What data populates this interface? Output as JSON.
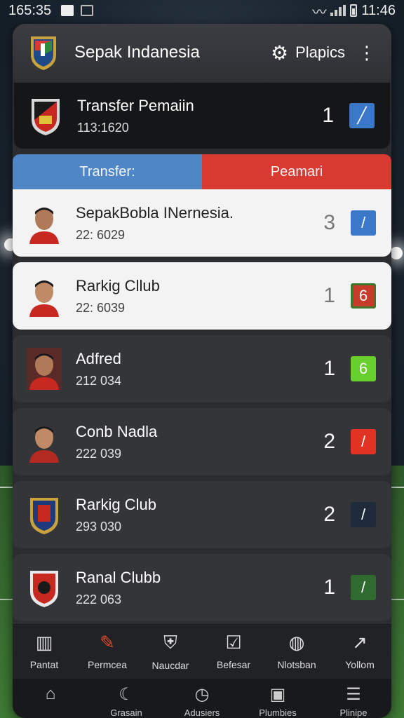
{
  "status": {
    "time": "165:35",
    "right_time": "11:46"
  },
  "header": {
    "title": "Sepak Indanesia",
    "settings_label": "Plapics",
    "gear_icon": "gear-icon",
    "more_icon": "more-vertical-icon"
  },
  "transfer": {
    "name": "Transfer Pemaiin",
    "sub": "113:1620",
    "count": "1",
    "badge_color": "#3a78c9"
  },
  "tabs": [
    {
      "label": "Transfer:",
      "color": "#4f87c6"
    },
    {
      "label": "Peamari",
      "color": "#d83a32"
    }
  ],
  "rows": [
    {
      "name": "SepakBobla INernesia.",
      "sub": "22: 6029",
      "count": "3",
      "badge": "/",
      "badge_color": "#3a78c9",
      "theme": "light"
    },
    {
      "name": "Rarkig Cllub",
      "sub": "22: 6039",
      "count": "1",
      "badge": "6",
      "badge_color": "#c73b2a",
      "theme": "light2"
    },
    {
      "name": "Adfred",
      "sub": "212 034",
      "count": "1",
      "badge": "6",
      "badge_color": "#67cf2e",
      "theme": "dark"
    },
    {
      "name": "Conb Nadla",
      "sub": "222 039",
      "count": "2",
      "badge": "/",
      "badge_color": "#e03324",
      "theme": "dark"
    },
    {
      "name": "Rarkig Club",
      "sub": "293 030",
      "count": "2",
      "badge": "/",
      "badge_color": "#1f2a3a",
      "theme": "dark"
    },
    {
      "name": "Ranal Clubb",
      "sub": "222 063",
      "count": "1",
      "badge": "/",
      "badge_color": "#2f6a2e",
      "theme": "dark"
    }
  ],
  "nav_primary": [
    {
      "label": "Pantat",
      "icon": "building-icon"
    },
    {
      "label": "Permcea",
      "icon": "pen-icon"
    },
    {
      "label": "Naucdar",
      "icon": "shield-icon"
    },
    {
      "label": "Befesar",
      "icon": "clipboard-icon"
    },
    {
      "label": "Nlotsban",
      "icon": "drop-icon"
    },
    {
      "label": "Yollom",
      "icon": "chart-icon"
    }
  ],
  "nav_secondary": [
    {
      "label": "",
      "icon": "home-icon"
    },
    {
      "label": "Grasain",
      "icon": "moon-icon"
    },
    {
      "label": "Adusiers",
      "icon": "clock-icon"
    },
    {
      "label": "Plumbies",
      "icon": "phone-icon"
    },
    {
      "label": "Plinipe",
      "icon": "stack-icon"
    }
  ]
}
